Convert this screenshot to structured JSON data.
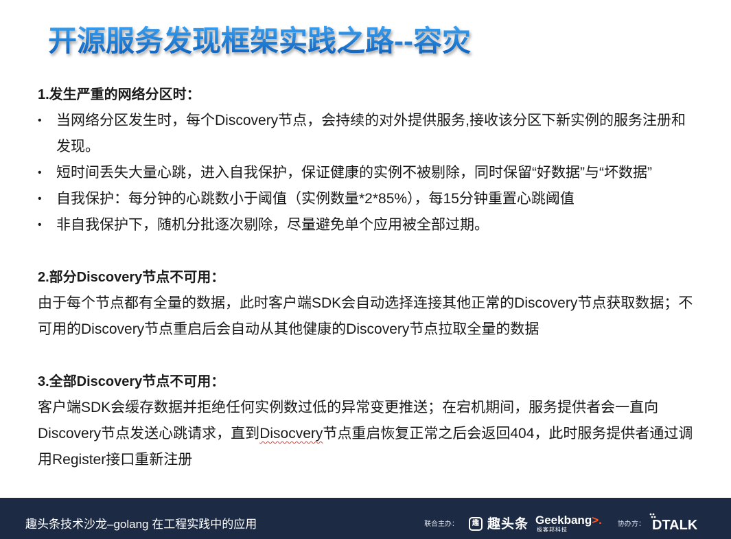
{
  "slide": {
    "title": "开源服务发现框架实践之路--容灾"
  },
  "section1": {
    "heading": "1.发生严重的网络分区时：",
    "bullet_glyph": "•",
    "bullets": [
      {
        "lines": [
          "当网络分区发生时，每个Discovery节点，会持续的对外提供服务,接收该分区下新实例的服务注册和",
          "发现。"
        ]
      },
      {
        "lines": [
          "短时间丢失大量心跳，进入自我保护，保证健康的实例不被剔除，同时保留“好数据”与“坏数据”"
        ]
      },
      {
        "lines": [
          "自我保护：每分钟的心跳数小于阈值（实例数量*2*85%），每15分钟重置心跳阈值"
        ]
      },
      {
        "lines": [
          "非自我保护下，随机分批逐次剔除，尽量避免单个应用被全部过期。"
        ]
      }
    ]
  },
  "section2": {
    "heading": "2.部分Discovery节点不可用：",
    "lines": [
      "由于每个节点都有全量的数据，此时客户端SDK会自动选择连接其他正常的Discovery节点获取数据；不",
      "可用的Discovery节点重启后会自动从其他健康的Discovery节点拉取全量的数据"
    ]
  },
  "section3": {
    "heading": "3.全部Discovery节点不可用：",
    "line1": "客户端SDK会缓存数据并拒绝任何实例数过低的异常变更推送；在宕机期间，服务提供者会一直向",
    "line2": {
      "before": "Discovery节点发送心跳请求，直到",
      "flagged_word": "Disocvery",
      "after": "节点重启恢复正常之后会返回404，此时服务提供者通过调"
    },
    "line3": "用Register接口重新注册"
  },
  "footer": {
    "event": "趣头条技术沙龙–golang 在工程实践中的应用",
    "co_host_label": "联合主办：",
    "qutoutiao": {
      "icon_glyph": "趣",
      "name": "趣头条"
    },
    "geekbang": {
      "word1": "Geek",
      "word2": "bang",
      "mark": ">.",
      "subtitle": "极客邦科技"
    },
    "assist_label": "协办方：",
    "dtalk": {
      "name": "DTALK"
    }
  },
  "icons": {
    "bullet": "bullet-icon",
    "qutoutiao_logo": "qutoutiao-logo-icon",
    "dtalk_logo_mark": "dtalk-logo-mark-icon"
  },
  "colors": {
    "title_top": "#3ba3f3",
    "title_bottom": "#0b5cb7",
    "body_text": "#1a1a1a",
    "footer_bg": "#1c2a44",
    "footer_text": "#ffffff",
    "geekbang_accent": "#ff5a1f",
    "spellcheck": "#e53935"
  }
}
